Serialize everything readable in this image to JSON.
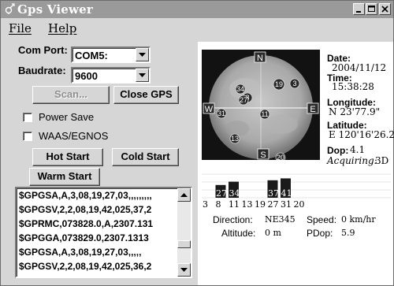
{
  "window": {
    "title": "Gps Viewer",
    "buttons": [
      "minimize",
      "maximize",
      "close"
    ]
  },
  "menu": {
    "items": [
      {
        "label": "File",
        "mnemonic": "F",
        "rest": "ile"
      },
      {
        "label": "Help",
        "mnemonic": "H",
        "rest": "elp"
      }
    ]
  },
  "connection": {
    "com_port_label": "Com Port:",
    "com_port_value": "COM5:",
    "baudrate_label": "Baudrate:",
    "baudrate_value": "9600",
    "scan_label": "Scan...",
    "scan_enabled": false,
    "close_gps_label": "Close GPS"
  },
  "options": {
    "power_save_label": "Power Save",
    "power_save_checked": false,
    "waas_label": "WAAS/EGNOS",
    "waas_checked": false
  },
  "start_buttons": {
    "hot_start": "Hot Start",
    "cold_start": "Cold Start",
    "warm_start": "Warm Start"
  },
  "nmea_log": [
    "$GPGSA,A,3,08,19,27,03,,,,,,,,,",
    "$GPGSV,2,2,08,19,42,025,37,2",
    "$GPRMC,073828.0,A,2307.131",
    "$GPGGA,073829.0,2307.1313",
    "$GPGSA,A,3,08,19,27,03,,,,,",
    "$GPGSV,2,2,08,19,42,025,36,2"
  ],
  "sky": {
    "directions": [
      "N",
      "E",
      "S",
      "W"
    ],
    "satellites": [
      "3",
      "19",
      "34",
      "8",
      "27",
      "31",
      "11",
      "13",
      "20"
    ]
  },
  "info": {
    "date_label": "Date:",
    "date_value": "2004/11/12",
    "time_label": "Time:",
    "time_value": "15:38:28",
    "longitude_label": "Longitude:",
    "longitude_value": "N 23'77.9\"",
    "latitude_label": "Latitude:",
    "latitude_value": "E 120'16'26.2\"",
    "dop_label": "Dop:",
    "dop_value": "4.1",
    "acquiring_label": "Acquiring:",
    "acquiring_value": "3D"
  },
  "signal": {
    "bars": [
      {
        "prn": "3",
        "value": ""
      },
      {
        "prn": "8",
        "value": "27"
      },
      {
        "prn": "11",
        "value": "34"
      },
      {
        "prn": "13",
        "value": ""
      },
      {
        "prn": "19",
        "value": ""
      },
      {
        "prn": "27",
        "value": "37"
      },
      {
        "prn": "31",
        "value": "41"
      },
      {
        "prn": "20",
        "value": ""
      }
    ],
    "bar_levels": [
      0,
      27,
      34,
      0,
      0,
      37,
      41,
      0
    ]
  },
  "status": {
    "direction_label": "Direction:",
    "direction_value": "NE345",
    "speed_label": "Speed:",
    "speed_value": "0 km/hr",
    "altitude_label": "Altitude:",
    "altitude_value": "0 m",
    "pdop_label": "PDop:",
    "pdop_value": "5.9"
  },
  "colors": {
    "titlebar": "#9a9a9a",
    "window_bg": "#d6d6d6",
    "sky_bg": "#121212",
    "bar_fill": "#1a1a1a"
  }
}
